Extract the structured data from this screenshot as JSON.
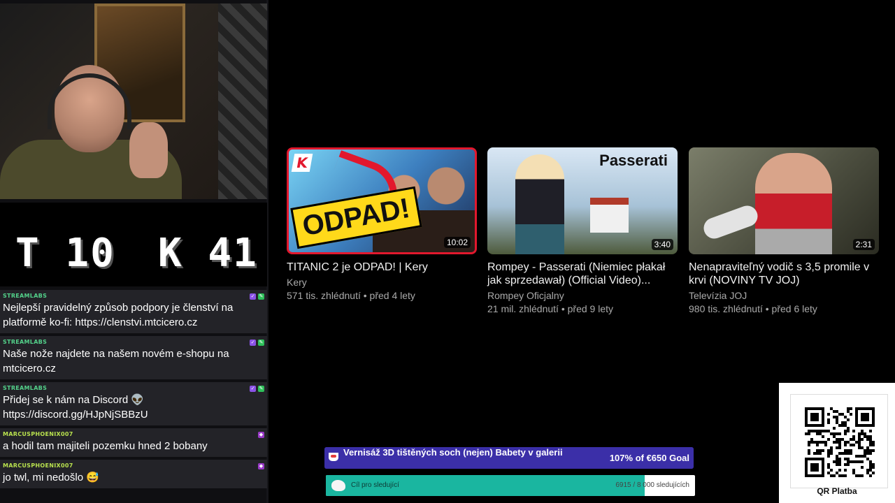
{
  "scoreboard": {
    "left": "T 10",
    "right": "K 41"
  },
  "chat": [
    {
      "user": "STREAMLABS",
      "text": "Nejlepší pravidelný způsob podpory je členství na platformě ko-fi: https://clenstvi.mtcicero.cz",
      "type": "sl"
    },
    {
      "user": "STREAMLABS",
      "text": "Naše nože najdete na našem novém e-shopu na mtcicero.cz",
      "type": "sl"
    },
    {
      "user": "STREAMLABS",
      "text": "Přidej se k nám na Discord 👽 https://discord.gg/HJpNjSBBzU",
      "type": "sl"
    },
    {
      "user": "MARCUSPHOENIX007",
      "text": "a hodil tam majiteli pozemku hned 2 bobany",
      "type": "mp"
    },
    {
      "user": "MARCUSPHOENIX007",
      "text": "jo twl, mi nedošlo 😅",
      "type": "mp"
    }
  ],
  "videos": [
    {
      "title": "TITANIC 2 je ODPAD! | Kery",
      "channel": "Kery",
      "meta": "571 tis. zhlédnutí • před 4 lety",
      "duration": "10:02",
      "thumb_text": "ODPAD!"
    },
    {
      "title": "Rompey - Passerati (Niemiec płakał jak sprzedawał) (Official Video)...",
      "channel": "Rompey Oficjalny",
      "meta": "21 mil. zhlédnutí • před 9 lety",
      "duration": "3:40",
      "thumb_text": "Passerati"
    },
    {
      "title": "Nenapraviteľný vodič s 3,5 promile v krvi (NOVINY TV JOJ)",
      "channel": "Televízia JOJ",
      "meta": "980 tis. zhlédnutí • před 6 lety",
      "duration": "2:31"
    }
  ],
  "goals": {
    "tip": {
      "title": "Vernisáž 3D tištěných soch (nejen) Babety v galerii",
      "progress": "107% of €650 Goal",
      "fraction": 1.0
    },
    "followers": {
      "label": "Cíl pro sledující",
      "progress": "6915 / 8 000 sledujících",
      "current": 6915,
      "target": 8000
    }
  },
  "qr": {
    "label": "QR Platba"
  },
  "colors": {
    "youtube_meta": "#aaaaaa",
    "tip_goal": "#2e2588",
    "follower_goal": "#1ab6a0"
  }
}
